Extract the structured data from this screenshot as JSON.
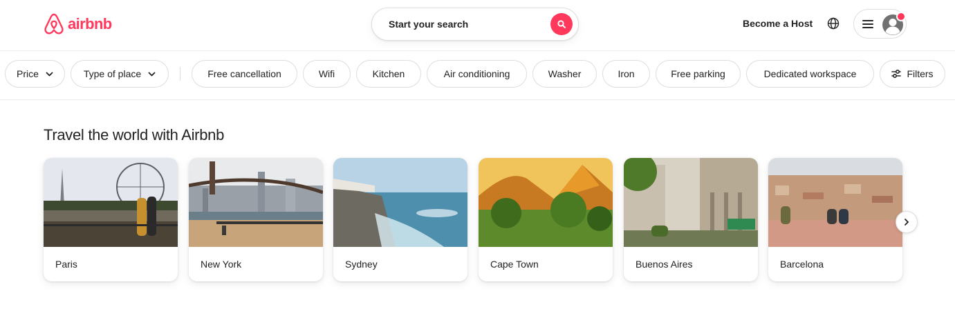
{
  "header": {
    "logo_text": "airbnb",
    "search_label": "Start your search",
    "host_label": "Become a Host",
    "icons": [
      "airbnb-logo-icon",
      "search-icon",
      "globe-icon",
      "menu-icon",
      "avatar-icon"
    ]
  },
  "filters": [
    {
      "label": "Price",
      "dropdown": true
    },
    {
      "label": "Type of place",
      "dropdown": true
    },
    {
      "label": "Free cancellation"
    },
    {
      "label": "Wifi"
    },
    {
      "label": "Kitchen"
    },
    {
      "label": "Air conditioning"
    },
    {
      "label": "Washer"
    },
    {
      "label": "Iron"
    },
    {
      "label": "Free parking"
    },
    {
      "label": "Dedicated workspace"
    },
    {
      "label": "Filters",
      "icon": "sliders-icon"
    }
  ],
  "section": {
    "title": "Travel the world with Airbnb",
    "destinations": [
      {
        "name": "Paris"
      },
      {
        "name": "New York"
      },
      {
        "name": "Sydney"
      },
      {
        "name": "Cape Town"
      },
      {
        "name": "Buenos Aires"
      },
      {
        "name": "Barcelona"
      }
    ]
  },
  "colors": {
    "brand": "#FF385C",
    "text": "#222222",
    "border": "#DDDDDD"
  }
}
